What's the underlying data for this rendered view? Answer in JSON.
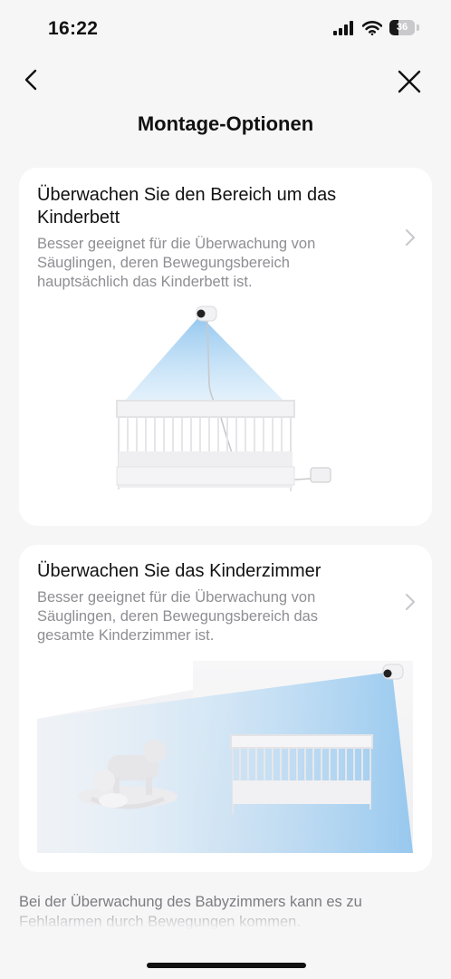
{
  "status_bar": {
    "time": "16:22",
    "battery_level": "36",
    "battery_fraction": 0.36,
    "icons": [
      "cellular-signal-icon",
      "wifi-icon",
      "battery-icon"
    ]
  },
  "nav": {
    "title": "Montage-Optionen",
    "back_icon": "chevron-left-icon",
    "close_icon": "close-icon"
  },
  "options": [
    {
      "title": "Überwachen Sie den Bereich um das Kinderbett",
      "description": "Besser geeignet für die Überwachung von Säuglingen, deren Bewegungsbereich hauptsächlich das Kinderbett ist.",
      "illustration": "crib-camera-illustration"
    },
    {
      "title": "Überwachen Sie das Kinderzimmer",
      "description": "Besser geeignet für die Überwachung von Säuglingen, deren Bewegungsbereich das gesamte Kinderzimmer ist.",
      "illustration": "nursery-room-illustration"
    }
  ],
  "footer": {
    "text": "Bei der Überwachung des Babyzimmers kann es zu Fehlalarmen durch Bewegungen kommen."
  },
  "colors": {
    "background": "#f6f6f7",
    "card": "#ffffff",
    "title": "#111111",
    "secondary": "#8e8e93",
    "camera_beam": "#9fcdf0"
  }
}
